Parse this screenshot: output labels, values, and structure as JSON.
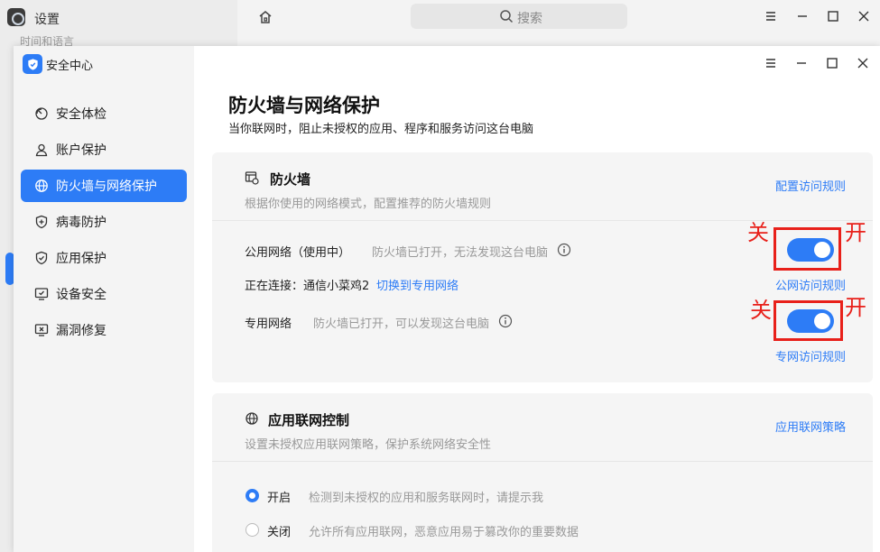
{
  "background_window": {
    "title": "设置",
    "subtitle": "时间和语言",
    "search_placeholder": "搜索"
  },
  "app": {
    "title": "安全中心"
  },
  "sidebar": {
    "items": [
      {
        "label": "安全体检",
        "icon": "scan-icon",
        "active": false
      },
      {
        "label": "账户保护",
        "icon": "user-icon",
        "active": false
      },
      {
        "label": "防火墙与网络保护",
        "icon": "globe-icon",
        "active": true
      },
      {
        "label": "病毒防护",
        "icon": "shield-plus-icon",
        "active": false
      },
      {
        "label": "应用保护",
        "icon": "shield-check-icon",
        "active": false
      },
      {
        "label": "设备安全",
        "icon": "monitor-check-icon",
        "active": false
      },
      {
        "label": "漏洞修复",
        "icon": "monitor-x-icon",
        "active": false
      }
    ]
  },
  "main": {
    "title": "防火墙与网络保护",
    "subtitle": "当你联网时，阻止未授权的应用、程序和服务访问这台电脑",
    "firewall": {
      "title": "防火墙",
      "desc": "根据你使用的网络模式，配置推荐的防火墙规则",
      "config_link": "配置访问规则",
      "public": {
        "label": "公用网络（使用中）",
        "hint": "防火墙已打开，无法发现这台电脑",
        "link": "公网访问规则",
        "enabled": true
      },
      "connecting_label": "正在连接：",
      "connecting_network": "通信小菜鸡2",
      "switch_link": "切换到专用网络",
      "private": {
        "label": "专用网络",
        "hint": "防火墙已打开，可以发现这台电脑",
        "link": "专网访问规则",
        "enabled": true
      }
    },
    "app_control": {
      "title": "应用联网控制",
      "desc": "设置未授权应用联网策略，保护系统网络安全性",
      "policy_link": "应用联网策略",
      "options": [
        {
          "label": "开启",
          "hint": "检测到未授权的应用和服务联网时，请提示我",
          "checked": true
        },
        {
          "label": "关闭",
          "hint": "允许所有应用联网，恶意应用易于篡改你的重要数据",
          "checked": false
        }
      ]
    }
  },
  "annotations": {
    "off_label": "关",
    "on_label": "开",
    "color": "#e8201a"
  },
  "colors": {
    "accent": "#2d7cf6"
  }
}
